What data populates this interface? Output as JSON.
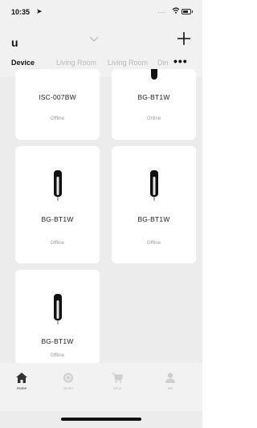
{
  "status_bar": {
    "time": "10:35",
    "location_icon": "location-arrow-icon",
    "signal_dots": "....",
    "wifi_icon": "wifi-icon",
    "battery_icon": "battery-icon"
  },
  "header": {
    "home_name": "u",
    "dropdown_icon": "chevron-down-icon",
    "add_icon": "plus-icon"
  },
  "room_tabs": {
    "items": [
      {
        "label": "Device",
        "active": true
      },
      {
        "label": "Living Room",
        "active": false
      },
      {
        "label": "Living Room",
        "active": false
      },
      {
        "label": "Din",
        "active": false
      }
    ],
    "more": "•••"
  },
  "devices": [
    {
      "name": "ISC-007BW",
      "status": "Offline"
    },
    {
      "name": "BG-BT1W",
      "status": "Online"
    },
    {
      "name": "BG-BT1W",
      "status": "Offline"
    },
    {
      "name": "BG-BT1W",
      "status": "Offline"
    },
    {
      "name": "BG-BT1W",
      "status": "Offline"
    }
  ],
  "tab_bar": {
    "items": [
      {
        "label": "Home",
        "icon": "home-icon",
        "active": true
      },
      {
        "label": "Smart",
        "icon": "smart-icon",
        "active": false
      },
      {
        "label": "Shop",
        "icon": "cart-icon",
        "active": false
      },
      {
        "label": "Me",
        "icon": "person-icon",
        "active": false
      }
    ]
  },
  "colors": {
    "background": "#ececec",
    "card": "#ffffff",
    "active_text": "#111111",
    "inactive_text": "#b9b9b9"
  }
}
